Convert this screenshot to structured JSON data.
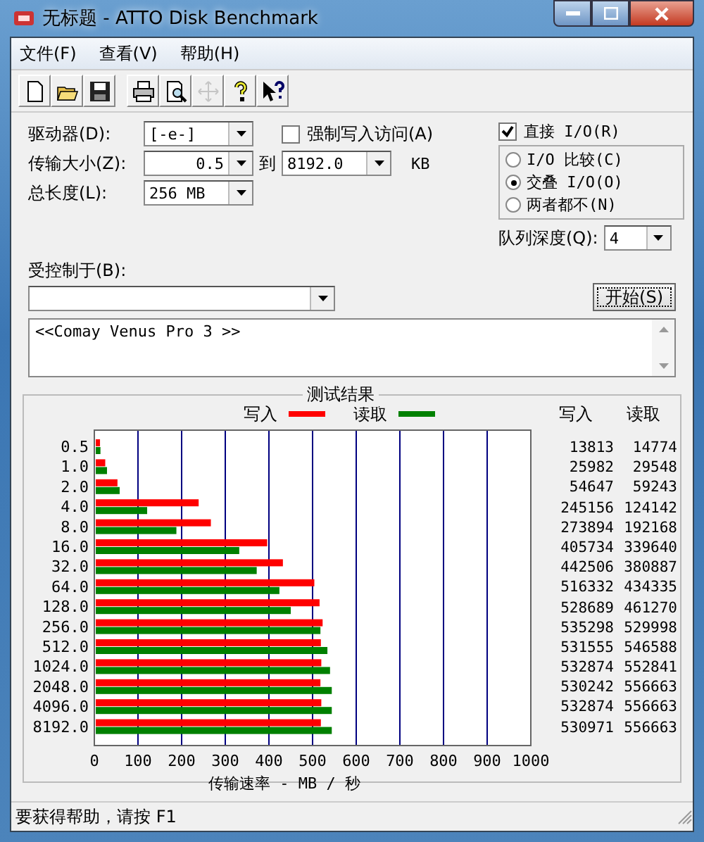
{
  "window": {
    "title": "无标题 - ATTO Disk Benchmark"
  },
  "menu": [
    "文件(F)",
    "查看(V)",
    "帮助(H)"
  ],
  "toolbar": [
    {
      "kind": "new",
      "disabled": false
    },
    {
      "kind": "open",
      "disabled": false
    },
    {
      "kind": "save",
      "disabled": false
    },
    {
      "kind": "print",
      "disabled": false
    },
    {
      "kind": "preview",
      "disabled": false
    },
    {
      "kind": "move",
      "disabled": true
    },
    {
      "kind": "help",
      "disabled": false
    },
    {
      "kind": "context-help",
      "disabled": false
    }
  ],
  "drive": {
    "label": "驱动器(D):",
    "value": "[-e-]"
  },
  "transfer_size": {
    "label": "传输大小(Z):",
    "from": "0.5",
    "to_label": "到",
    "to": "8192.0",
    "unit": "KB"
  },
  "total_length": {
    "label": "总长度(L):",
    "value": "256 MB"
  },
  "force_write": {
    "label": "强制写入访问(A)",
    "checked": false
  },
  "direct_io": {
    "label": "直接 I/O(R)",
    "checked": true
  },
  "io_modes": [
    {
      "label": "I/O 比较(C)",
      "selected": false
    },
    {
      "label": "交叠 I/O(O)",
      "selected": true
    },
    {
      "label": "两者都不(N)",
      "selected": false
    }
  ],
  "queue_depth": {
    "label": "队列深度(Q):",
    "value": "4"
  },
  "controlled_by": {
    "label": "受控制于(B):"
  },
  "start_button": "开始(S)",
  "description": "<<Comay Venus Pro 3 >>",
  "results": {
    "chart_data": {
      "type": "bar",
      "orientation": "horizontal",
      "title": "测试结果",
      "xlabel": "传输速率 - MB / 秒",
      "categories": [
        "0.5",
        "1.0",
        "2.0",
        "4.0",
        "8.0",
        "16.0",
        "32.0",
        "64.0",
        "128.0",
        "256.0",
        "512.0",
        "1024.0",
        "2048.0",
        "4096.0",
        "8192.0"
      ],
      "series": [
        {
          "name": "写入",
          "color": "#ff0000",
          "values": [
            13,
            25,
            53,
            239,
            267,
            396,
            432,
            504,
            516,
            523,
            519,
            520,
            518,
            520,
            519
          ]
        },
        {
          "name": "读取",
          "color": "#008000",
          "values": [
            14,
            29,
            58,
            121,
            188,
            332,
            372,
            424,
            450,
            518,
            534,
            540,
            544,
            544,
            544
          ]
        }
      ],
      "grid": true,
      "xlim": [
        0,
        1000
      ],
      "xticks": [
        0,
        100,
        200,
        300,
        400,
        500,
        600,
        700,
        800,
        900,
        1000
      ]
    },
    "columns": [
      "写入",
      "读取"
    ],
    "rows": [
      [
        "13813",
        "14774"
      ],
      [
        "25982",
        "29548"
      ],
      [
        "54647",
        "59243"
      ],
      [
        "245156",
        "124142"
      ],
      [
        "273894",
        "192168"
      ],
      [
        "405734",
        "339640"
      ],
      [
        "442506",
        "380887"
      ],
      [
        "516332",
        "434335"
      ],
      [
        "528689",
        "461270"
      ],
      [
        "535298",
        "529998"
      ],
      [
        "531555",
        "546588"
      ],
      [
        "532874",
        "552841"
      ],
      [
        "530242",
        "556663"
      ],
      [
        "532874",
        "556663"
      ],
      [
        "530971",
        "556663"
      ]
    ]
  },
  "status_bar": "要获得帮助，请按 F1"
}
